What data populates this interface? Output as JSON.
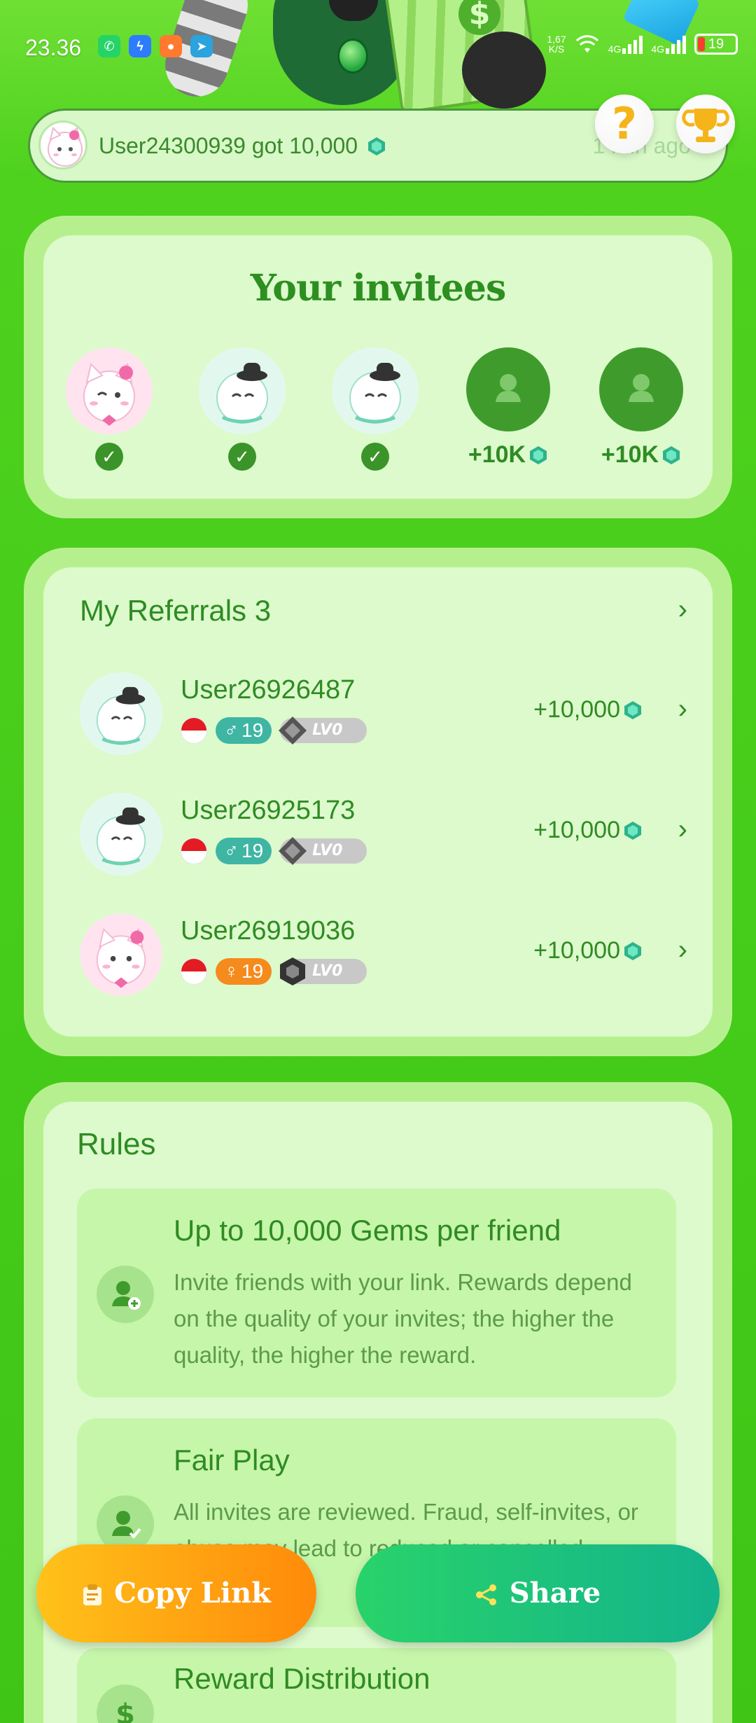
{
  "status_bar": {
    "time": "23.36",
    "net_speed_top": "1,67",
    "net_speed_bottom": "K/S",
    "sim1": "4G",
    "sim2": "4G",
    "battery": "19"
  },
  "ticker": {
    "message": "User24300939 got 10,000",
    "time_ago": "1 min ago"
  },
  "invitees": {
    "title": "Your invitees",
    "slots": [
      {
        "state": "done"
      },
      {
        "state": "done"
      },
      {
        "state": "done"
      },
      {
        "state": "empty",
        "reward": "+10K"
      },
      {
        "state": "empty",
        "reward": "+10K"
      }
    ]
  },
  "referrals": {
    "title": "My Referrals 3",
    "items": [
      {
        "name": "User26926487",
        "age": "19",
        "gender": "male",
        "level": "LV0",
        "reward": "+10,000"
      },
      {
        "name": "User26925173",
        "age": "19",
        "gender": "male",
        "level": "LV0",
        "reward": "+10,000"
      },
      {
        "name": "User26919036",
        "age": "19",
        "gender": "female",
        "level": "LV0",
        "reward": "+10,000"
      }
    ]
  },
  "rules": {
    "title": "Rules",
    "items": [
      {
        "title": "Up to 10,000 Gems per friend",
        "text": "Invite friends with your link. Rewards depend on the quality of your invites; the higher the quality, the higher the reward."
      },
      {
        "title": "Fair Play",
        "text": "All invites are reviewed. Fraud, self-invites, or abuse may lead to reduced or cancelled rewards."
      },
      {
        "title": "Reward Distribution",
        "text": ""
      }
    ]
  },
  "buttons": {
    "copy_link": "Copy Link",
    "share": "Share"
  },
  "colors": {
    "background": "#46cc1a",
    "panel_outer": "#b6f08e",
    "panel_inner": "#dcfacc",
    "text_green": "#2f8b23",
    "copy_button": "#ffa10f",
    "share_button": "#1fc27a"
  }
}
